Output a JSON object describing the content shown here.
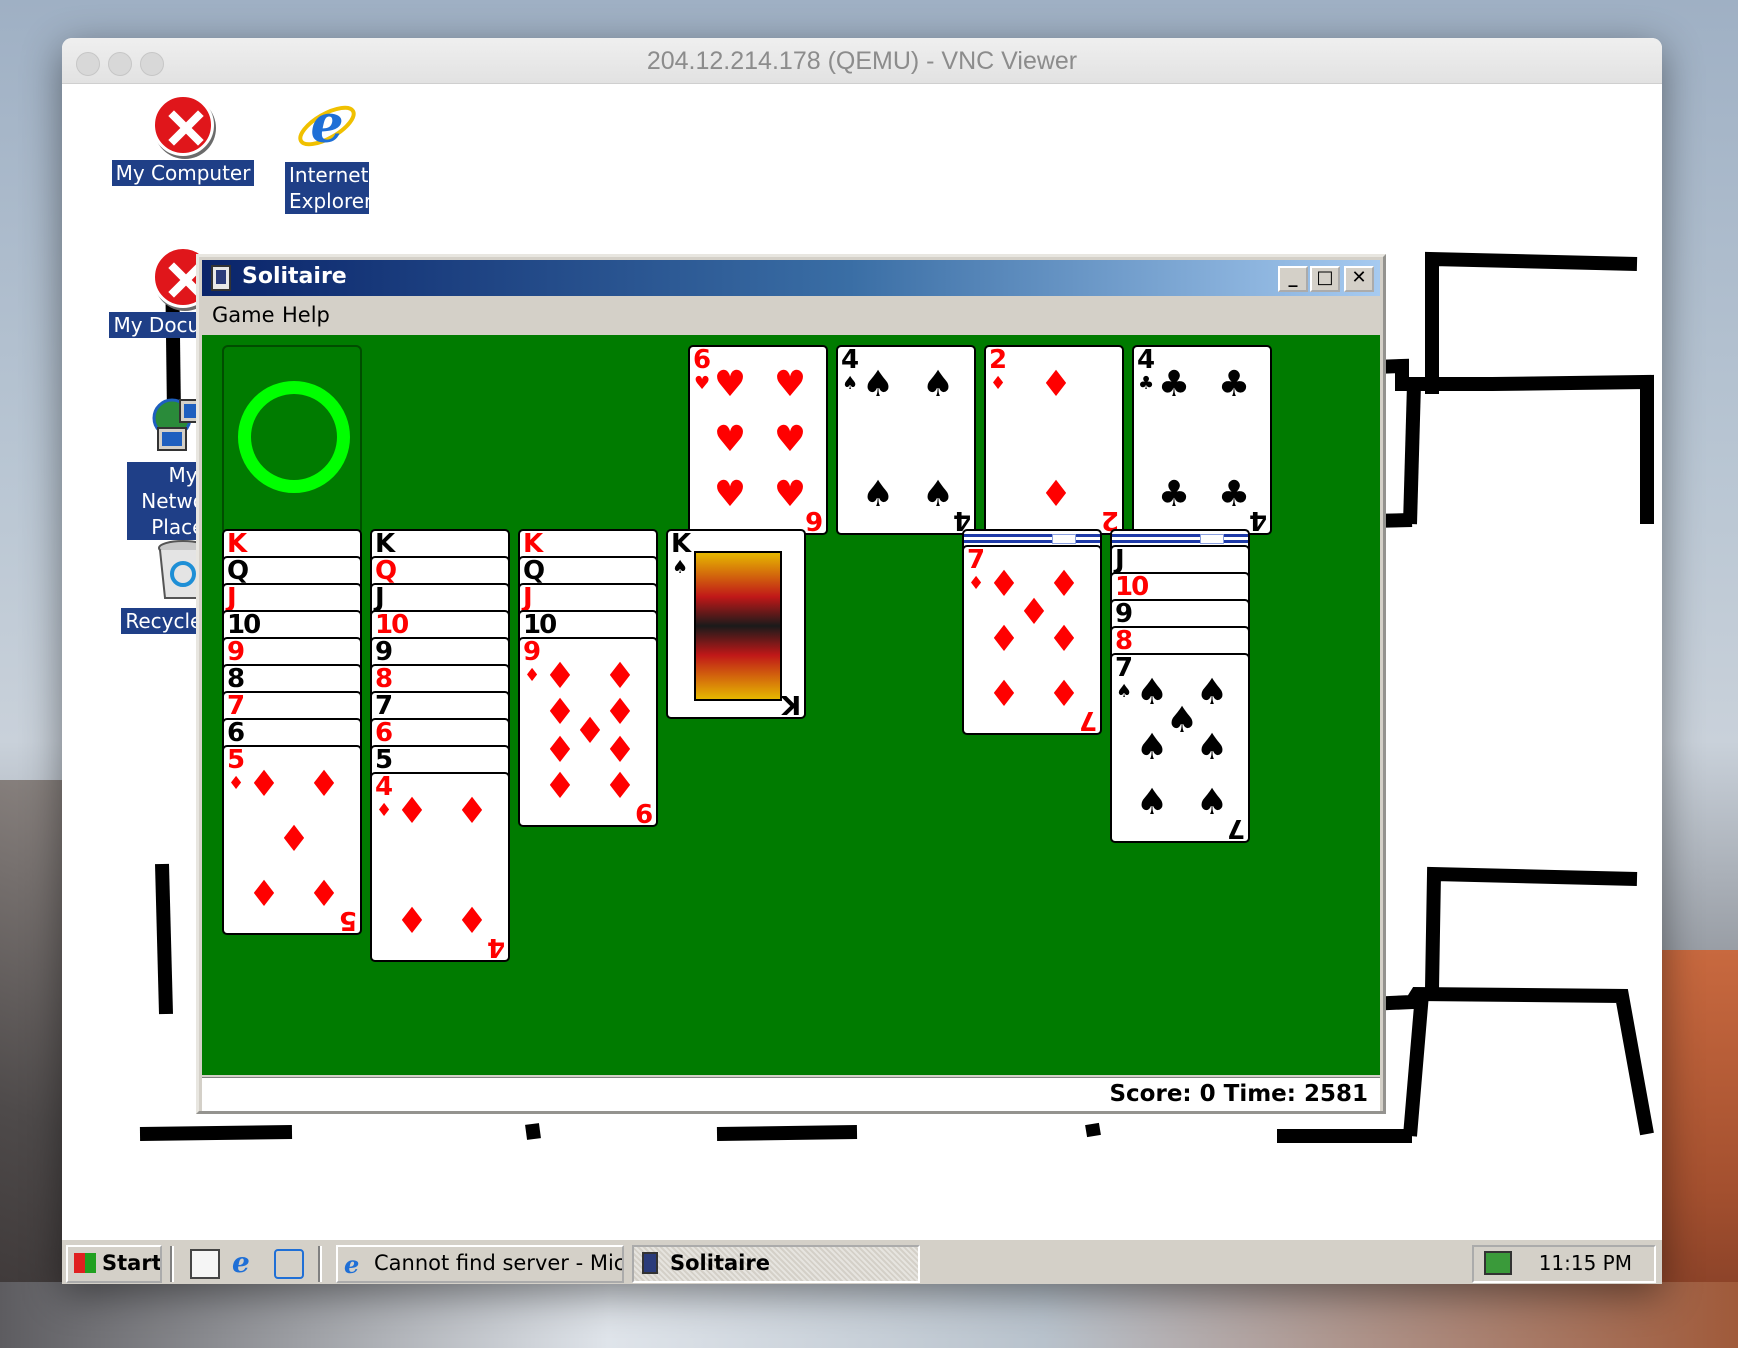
{
  "vnc": {
    "title": "204.12.214.178 (QEMU) - VNC Viewer"
  },
  "desktop_icons": [
    {
      "label": "My Computer",
      "icon": "error-icon"
    },
    {
      "label": "Internet Explorer",
      "icon": "internet-explorer-icon"
    },
    {
      "label": "My Document",
      "icon": "error-icon"
    },
    {
      "label": "My Network Places",
      "icon": "network-places-icon"
    },
    {
      "label": "Recycle Bin",
      "icon": "recycle-bin-icon"
    }
  ],
  "solitaire": {
    "title": "Solitaire",
    "menu": [
      "Game",
      "Help"
    ],
    "status": "Score: 0 Time: 2581",
    "foundations": [
      {
        "rank": "6",
        "suit": "♥",
        "color": "red"
      },
      {
        "rank": "4",
        "suit": "♠",
        "color": "black"
      },
      {
        "rank": "2",
        "suit": "♦",
        "color": "red"
      },
      {
        "rank": "4",
        "suit": "♣",
        "color": "black"
      }
    ],
    "tableau": [
      {
        "facedown": 0,
        "cards": [
          {
            "rank": "K",
            "suit": "♥",
            "color": "red"
          },
          {
            "rank": "Q",
            "suit": "♠",
            "color": "black"
          },
          {
            "rank": "J",
            "suit": "♥",
            "color": "red"
          },
          {
            "rank": "10",
            "suit": "♠",
            "color": "black"
          },
          {
            "rank": "9",
            "suit": "♥",
            "color": "red"
          },
          {
            "rank": "8",
            "suit": "♠",
            "color": "black"
          },
          {
            "rank": "7",
            "suit": "♥",
            "color": "red"
          },
          {
            "rank": "6",
            "suit": "♠",
            "color": "black"
          },
          {
            "rank": "5",
            "suit": "♦",
            "color": "red"
          }
        ]
      },
      {
        "facedown": 0,
        "cards": [
          {
            "rank": "K",
            "suit": "♣",
            "color": "black"
          },
          {
            "rank": "Q",
            "suit": "♥",
            "color": "red"
          },
          {
            "rank": "J",
            "suit": "♣",
            "color": "black"
          },
          {
            "rank": "10",
            "suit": "♥",
            "color": "red"
          },
          {
            "rank": "9",
            "suit": "♣",
            "color": "black"
          },
          {
            "rank": "8",
            "suit": "♥",
            "color": "red"
          },
          {
            "rank": "7",
            "suit": "♣",
            "color": "black"
          },
          {
            "rank": "6",
            "suit": "♦",
            "color": "red"
          },
          {
            "rank": "5",
            "suit": "♣",
            "color": "black"
          },
          {
            "rank": "4",
            "suit": "♦",
            "color": "red"
          }
        ]
      },
      {
        "facedown": 0,
        "cards": [
          {
            "rank": "K",
            "suit": "♦",
            "color": "red"
          },
          {
            "rank": "Q",
            "suit": "♣",
            "color": "black"
          },
          {
            "rank": "J",
            "suit": "♦",
            "color": "red"
          },
          {
            "rank": "10",
            "suit": "♣",
            "color": "black"
          },
          {
            "rank": "9",
            "suit": "♦",
            "color": "red"
          }
        ]
      },
      {
        "facedown": 0,
        "cards": [
          {
            "rank": "K",
            "suit": "♠",
            "color": "black"
          }
        ]
      },
      {
        "facedown": 0,
        "cards": []
      },
      {
        "facedown": 1,
        "cards": [
          {
            "rank": "7",
            "suit": "♦",
            "color": "red"
          }
        ]
      },
      {
        "facedown": 1,
        "cards": [
          {
            "rank": "J",
            "suit": "♠",
            "color": "black"
          },
          {
            "rank": "10",
            "suit": "♦",
            "color": "red"
          },
          {
            "rank": "9",
            "suit": "♠",
            "color": "black"
          },
          {
            "rank": "8",
            "suit": "♦",
            "color": "red"
          },
          {
            "rank": "7",
            "suit": "♠",
            "color": "black"
          }
        ]
      }
    ]
  },
  "taskbar": {
    "start_label": "Start",
    "tasks": [
      {
        "label": "Cannot find server - Micr...",
        "active": false
      },
      {
        "label": "Solitaire",
        "active": true
      }
    ],
    "clock": "11:15 PM"
  },
  "colors": {
    "felt": "#007b00",
    "titlebar_start": "#0a246a",
    "titlebar_end": "#a6caf0",
    "stock_ring": "#00ff00",
    "icon_label_bg": "#1f3f87"
  }
}
